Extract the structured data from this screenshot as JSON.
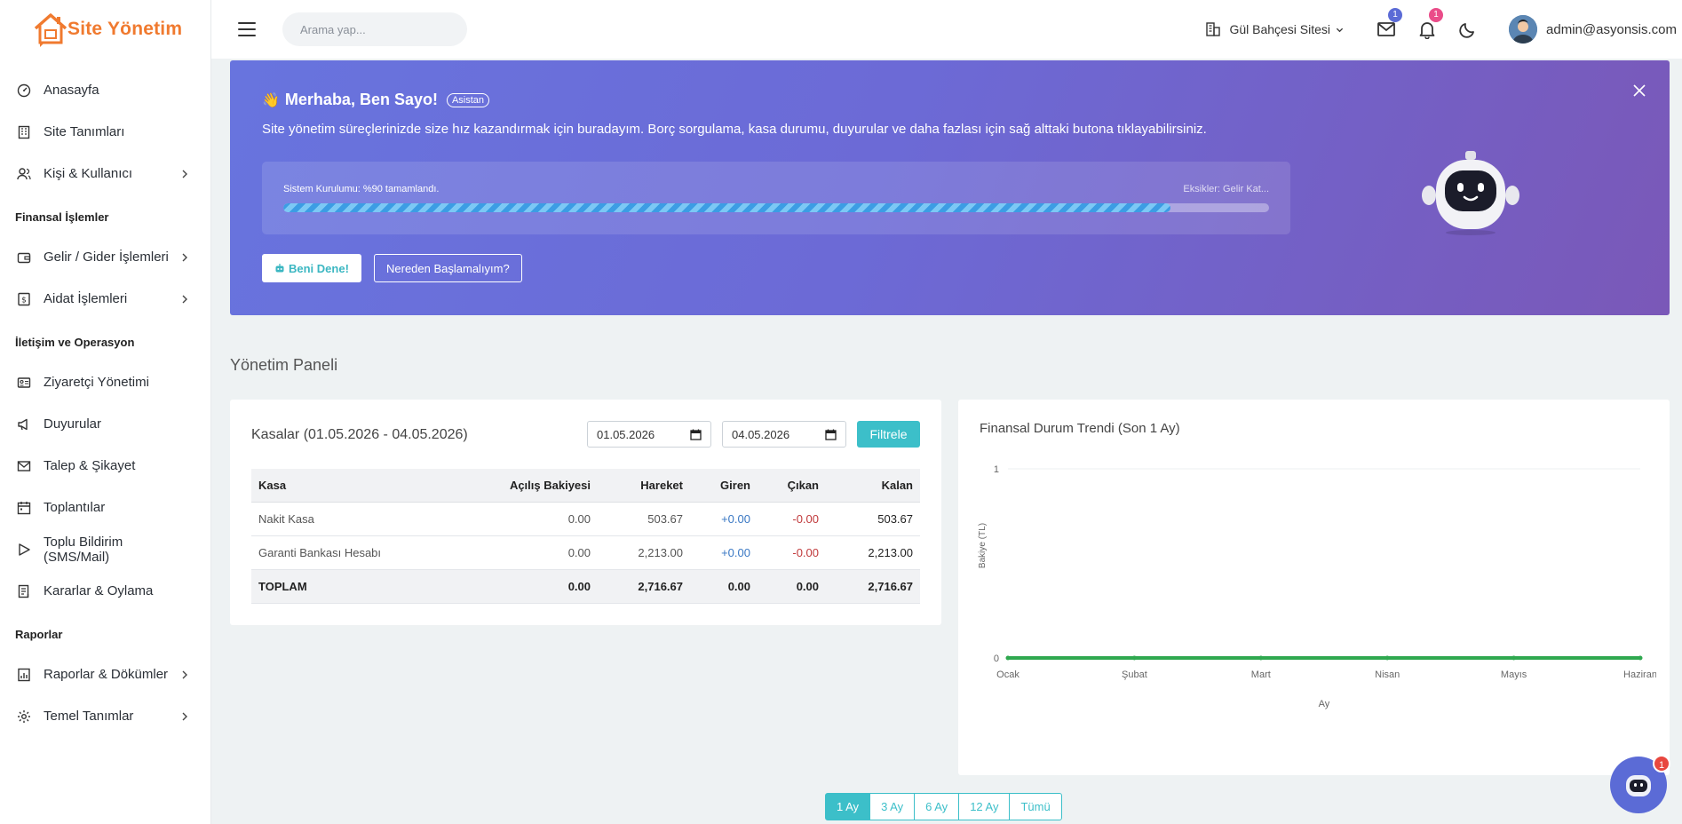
{
  "app": {
    "logo_text": "Site Yönetim"
  },
  "sidebar": {
    "items": [
      {
        "label": "Anasayfa",
        "icon": "dashboard-icon"
      },
      {
        "label": "Site Tanımları",
        "icon": "building-icon"
      },
      {
        "label": "Kişi & Kullanıcı",
        "icon": "users-icon",
        "has_children": true
      }
    ],
    "section_finance": "Finansal İşlemler",
    "finance_items": [
      {
        "label": "Gelir / Gider İşlemleri",
        "icon": "wallet-icon",
        "has_children": true
      },
      {
        "label": "Aidat İşlemleri",
        "icon": "money-icon",
        "has_children": true
      }
    ],
    "section_ops": "İletişim ve Operasyon",
    "ops_items": [
      {
        "label": "Ziyaretçi Yönetimi",
        "icon": "id-card-icon"
      },
      {
        "label": "Duyurular",
        "icon": "megaphone-icon"
      },
      {
        "label": "Talep & Şikayet",
        "icon": "mail-icon"
      },
      {
        "label": "Toplantılar",
        "icon": "calendar-icon"
      },
      {
        "label": "Toplu Bildirim (SMS/Mail)",
        "icon": "send-icon"
      },
      {
        "label": "Kararlar & Oylama",
        "icon": "document-icon"
      }
    ],
    "section_reports": "Raporlar",
    "report_items": [
      {
        "label": "Raporlar & Dökümler",
        "icon": "report-icon",
        "has_children": true
      },
      {
        "label": "Temel Tanımlar",
        "icon": "gear-icon",
        "has_children": true
      }
    ]
  },
  "header": {
    "search_placeholder": "Arama yap...",
    "site_name": "Gül Bahçesi Sitesi",
    "mail_count": "1",
    "notif_count": "1",
    "user_email": "admin@asyonsis.com"
  },
  "hero": {
    "title": "Merhaba, Ben Sayo!",
    "tag": "Asistan",
    "subtitle": "Site yönetim süreçlerinizde size hız kazandırmak için buradayım. Borç sorgulama, kasa durumu, duyurular ve daha fazlası için sağ alttaki butona tıklayabilirsiniz.",
    "progress_label": "Sistem Kurulumu: %90 tamamlandı.",
    "progress_missing": "Eksikler: Gelir Kat...",
    "progress_percent": 90,
    "try_label": "Beni Dene!",
    "start_label": "Nereden Başlamalıyım?"
  },
  "page": {
    "section_title": "Yönetim Paneli"
  },
  "kasa": {
    "title": "Kasalar (01.05.2026 - 04.05.2026)",
    "date_from": "01.05.2026",
    "date_to": "04.05.2026",
    "filter_label": "Filtrele",
    "columns": [
      "Kasa",
      "Açılış Bakiyesi",
      "Hareket",
      "Giren",
      "Çıkan",
      "Kalan"
    ],
    "rows": [
      [
        "Nakit Kasa",
        "0.00",
        "503.67",
        "+0.00",
        "-0.00",
        "503.67"
      ],
      [
        "Garanti Bankası Hesabı",
        "0.00",
        "2,213.00",
        "+0.00",
        "-0.00",
        "2,213.00"
      ]
    ],
    "total": [
      "TOPLAM",
      "0.00",
      "2,716.67",
      "0.00",
      "0.00",
      "2,716.67"
    ]
  },
  "trend": {
    "title": "Finansal Durum Trendi (Son 1 Ay)"
  },
  "chart_data": {
    "type": "line",
    "categories": [
      "Ocak",
      "Şubat",
      "Mart",
      "Nisan",
      "Mayıs",
      "Haziran"
    ],
    "values": [
      0,
      0,
      0,
      0,
      0,
      0
    ],
    "ylabel": "Bakiye (TL)",
    "xlabel": "Ay",
    "ylim": [
      0,
      1
    ],
    "yticks": [
      "0",
      "1"
    ],
    "line_color": "#2fa84f",
    "grid": true
  },
  "range": {
    "options": [
      "1 Ay",
      "3 Ay",
      "6 Ay",
      "12 Ay",
      "Tümü"
    ],
    "selected": "1 Ay"
  },
  "chat": {
    "badge": "1"
  },
  "colors": {
    "accent": "#3cbfc9",
    "brand": "#f07a2f",
    "hero": "#6874de"
  }
}
